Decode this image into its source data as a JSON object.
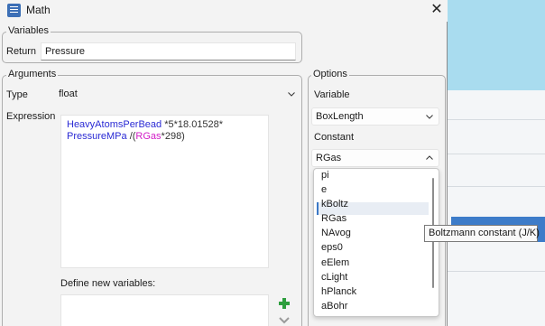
{
  "window": {
    "title": "Math",
    "close_label": "✕"
  },
  "variables_group": {
    "legend": "Variables",
    "return_label": "Return",
    "return_value": "Pressure"
  },
  "arguments_group": {
    "legend": "Arguments",
    "type_label": "Type",
    "type_value": "float",
    "expression_label": "Expression",
    "expression_tokens": [
      {
        "text": "HeavyAtomsPerBead",
        "kind": "var"
      },
      {
        "text": " *5*18.01528*",
        "kind": "op"
      },
      {
        "text": "PressureMPa",
        "kind": "var"
      },
      {
        "text": " /(",
        "kind": "op"
      },
      {
        "text": "RGas",
        "kind": "rgas"
      },
      {
        "text": "*298)",
        "kind": "op"
      }
    ],
    "define_new_label": "Define new variables:"
  },
  "options_group": {
    "legend": "Options",
    "variable_label": "Variable",
    "variable_value": "BoxLength",
    "constant_label": "Constant",
    "constant_value": "RGas"
  },
  "constant_dropdown": {
    "items": [
      "pi",
      "e",
      "kBoltz",
      "RGas",
      "NAvog",
      "eps0",
      "eElem",
      "cLight",
      "hPlanck",
      "aBohr"
    ],
    "highlighted_index": 2
  },
  "tooltip": {
    "text": "Boltzmann constant (J/K)"
  },
  "icons": {
    "add": "plus-icon",
    "expand": "chevron-down-icon"
  },
  "colors": {
    "variable": "#2a2ad4",
    "rgas": "#d21cc7",
    "add_green": "#2e9e3e",
    "selection": "#3b78c6"
  }
}
